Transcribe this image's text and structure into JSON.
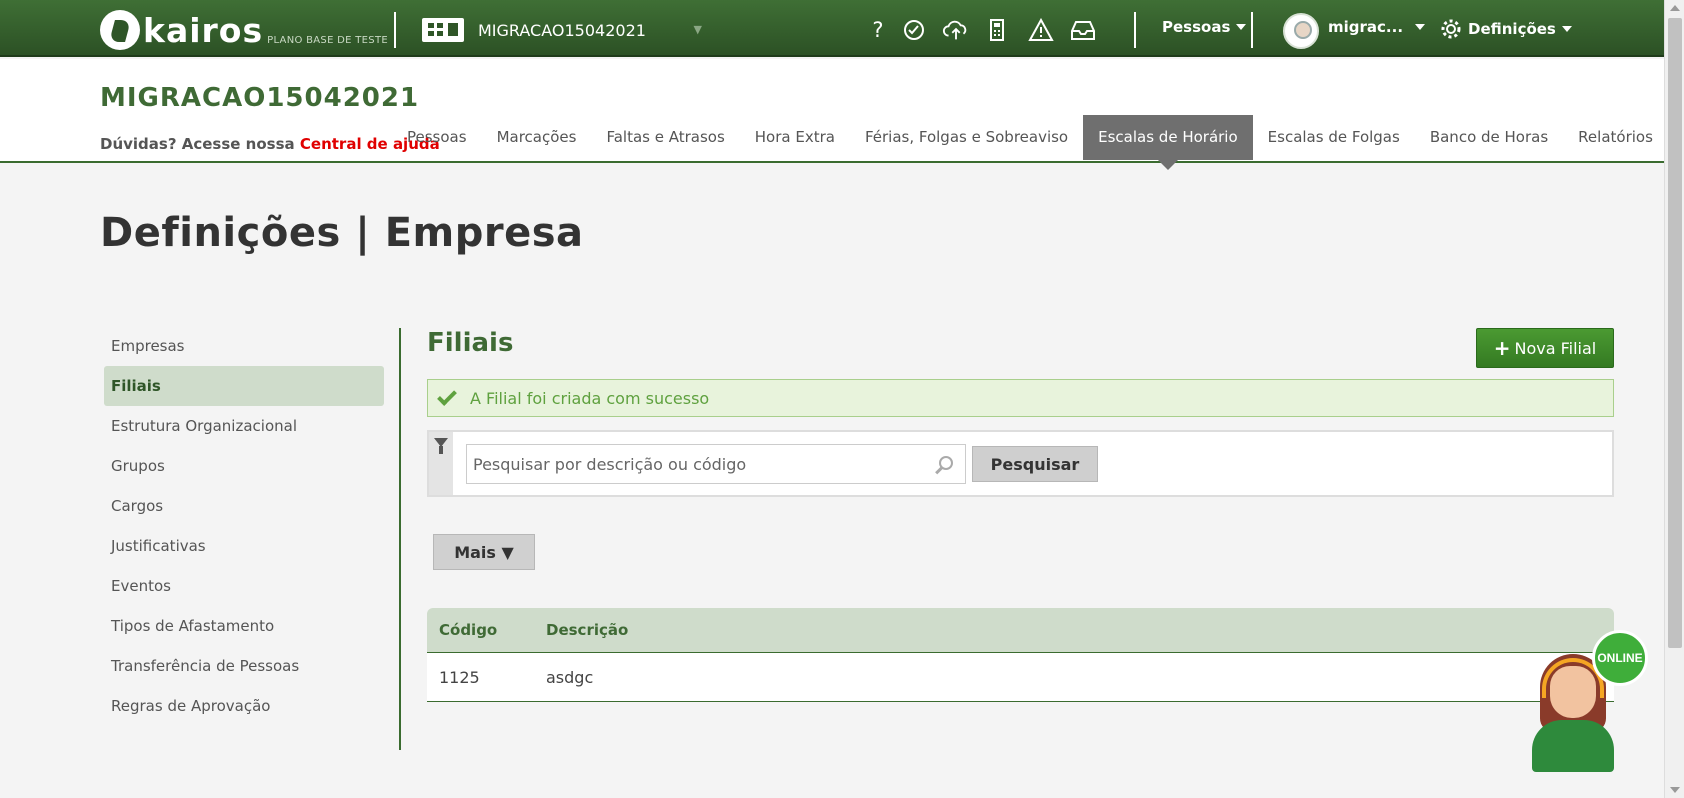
{
  "topbar": {
    "logo_text": "kairos",
    "logo_sub": "PLANO BASE DE TESTE",
    "company": "MIGRACAO15042021",
    "company_caret": "▼",
    "icons": [
      "help-icon",
      "clock-check-icon",
      "cloud-upload-icon",
      "calculator-icon",
      "warning-icon",
      "inbox-icon"
    ],
    "people_menu": "Pessoas",
    "user_menu": "migrac...",
    "settings_menu": "Definições"
  },
  "header": {
    "company_title": "MIGRACAO15042021",
    "help_prefix": "Dúvidas? Acesse nossa",
    "help_link": "Central de ajuda",
    "tabs": [
      "Pessoas",
      "Marcações",
      "Faltas e Atrasos",
      "Hora Extra",
      "Férias, Folgas e Sobreaviso",
      "Escalas de Horário",
      "Escalas de Folgas",
      "Banco de Horas",
      "Relatórios"
    ],
    "active_tab": "Escalas de Horário"
  },
  "page_title": "Definições | Empresa",
  "sidebar": {
    "items": [
      "Empresas",
      "Filiais",
      "Estrutura Organizacional",
      "Grupos",
      "Cargos",
      "Justificativas",
      "Eventos",
      "Tipos de Afastamento",
      "Transferência de Pessoas",
      "Regras de Aprovação"
    ],
    "active": "Filiais"
  },
  "main": {
    "title": "Filiais",
    "new_button": "Nova Filial",
    "alert": "A Filial foi criada com sucesso",
    "search_placeholder": "Pesquisar por descrição ou código",
    "search_value": "",
    "search_button": "Pesquisar",
    "more_button": "Mais ▼",
    "table": {
      "headers": [
        "Código",
        "Descrição"
      ],
      "rows": [
        [
          "1125",
          "asdgc"
        ]
      ]
    }
  },
  "support": {
    "badge": "ONLINE"
  },
  "colors": {
    "brand_green": "#3f6a35",
    "topbar": "#2f5628",
    "accent_button": "#3f8a2a",
    "alert_text": "#5fa13f",
    "active_tab": "#6f6f6f",
    "help_link": "#e00000"
  }
}
